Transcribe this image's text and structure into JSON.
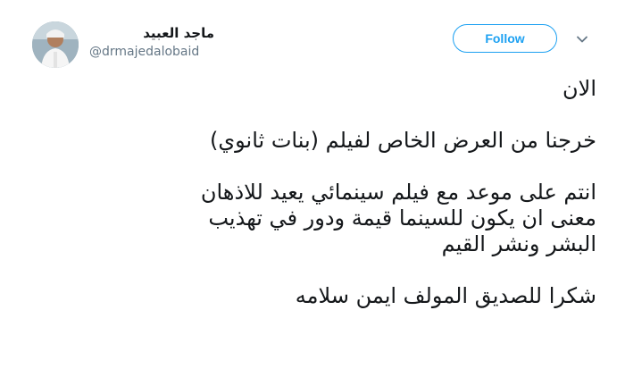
{
  "user": {
    "display_name": "ماجد العبيد",
    "handle": "@drmajedalobaid"
  },
  "actions": {
    "follow_label": "Follow"
  },
  "icons": {
    "caret": "chevron-down-icon"
  },
  "tweet": {
    "lines": [
      "الان",
      "خرجنا من العرض الخاص لفيلم (بنات ثانوي)",
      "انتم على موعد مع فيلم سينمائي يعيد للاذهان",
      "معنى ان يكون للسينما قيمة ودور في تهذيب",
      "البشر ونشر القيم",
      "شكرا للصديق المولف ايمن سلامه"
    ]
  },
  "colors": {
    "accent": "#1da1f2",
    "text": "#14171a",
    "muted": "#657786"
  }
}
